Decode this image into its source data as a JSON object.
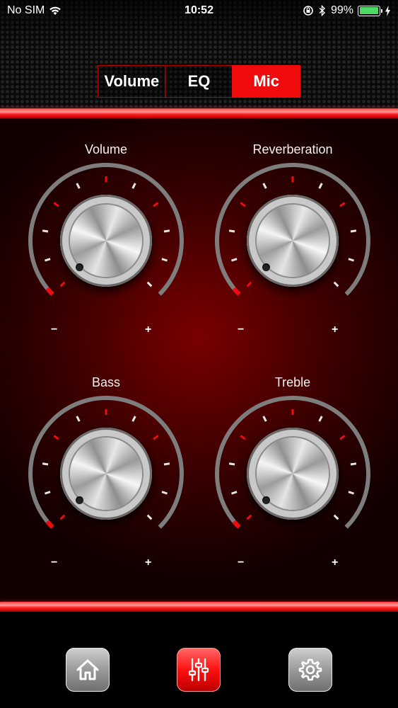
{
  "status_bar": {
    "carrier": "No SIM",
    "time": "10:52",
    "battery_percent": "99%",
    "battery_level": 0.99,
    "icons": [
      "wifi-icon",
      "orientation-lock-icon",
      "bluetooth-icon",
      "battery-icon",
      "charging-icon"
    ]
  },
  "tabs": [
    {
      "label": "Volume",
      "active": false
    },
    {
      "label": "EQ",
      "active": false
    },
    {
      "label": "Mic",
      "active": true
    }
  ],
  "knobs": [
    {
      "title": "Volume",
      "min_label": "−",
      "max_label": "+",
      "level": 0.0
    },
    {
      "title": "Reverberation",
      "min_label": "−",
      "max_label": "+",
      "level": 0.0
    },
    {
      "title": "Bass",
      "min_label": "−",
      "max_label": "+",
      "level": 0.0
    },
    {
      "title": "Treble",
      "min_label": "−",
      "max_label": "+",
      "level": 0.0
    }
  ],
  "toolbar": {
    "buttons": [
      {
        "icon": "home-icon",
        "active": false
      },
      {
        "icon": "mixer-sliders-icon",
        "active": true
      },
      {
        "icon": "gear-icon",
        "active": false
      }
    ]
  },
  "colors": {
    "accent": "#f00c0c",
    "tab_border": "#b20000",
    "battery": "#4cd964",
    "background_red": "#7a0000"
  }
}
